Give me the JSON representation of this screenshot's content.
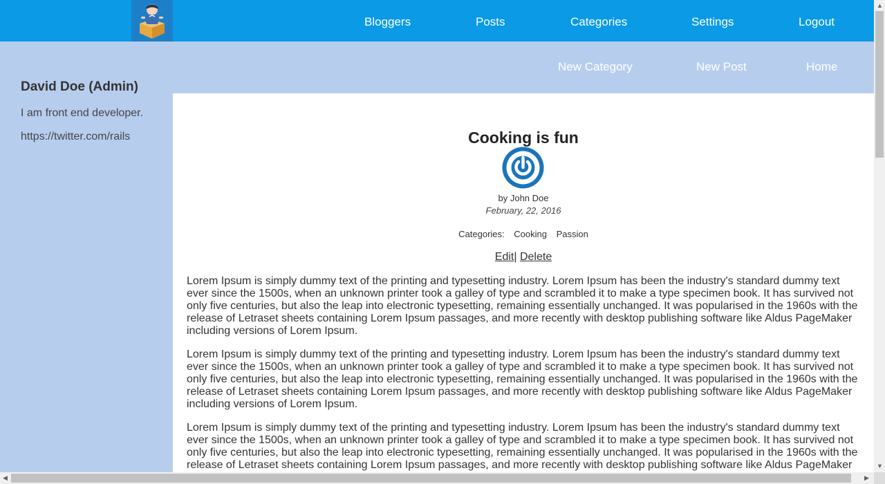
{
  "topnav": {
    "items": [
      {
        "label": "Bloggers"
      },
      {
        "label": "Posts"
      },
      {
        "label": "Categories"
      },
      {
        "label": "Settings"
      },
      {
        "label": "Logout"
      }
    ]
  },
  "subnav": {
    "items": [
      {
        "label": "New Category"
      },
      {
        "label": "New Post"
      },
      {
        "label": "Home"
      }
    ]
  },
  "sidebar": {
    "name": "David Doe (Admin)",
    "bio": "I am front end developer.",
    "link": "https://twitter.com/rails"
  },
  "post": {
    "title": "Cooking is fun",
    "author": "by John Doe",
    "date": "February, 22, 2016",
    "categories_label": "Categories:",
    "categories": [
      "Cooking",
      "Passion"
    ],
    "edit_label": "Edit",
    "separator": "|",
    "delete_label": "Delete",
    "paragraphs": [
      "Lorem Ipsum is simply dummy text of the printing and typesetting industry. Lorem Ipsum has been the industry's standard dummy text ever since the 1500s, when an unknown printer took a galley of type and scrambled it to make a type specimen book. It has survived not only five centuries, but also the leap into electronic typesetting, remaining essentially unchanged. It was popularised in the 1960s with the release of Letraset sheets containing Lorem Ipsum passages, and more recently with desktop publishing software like Aldus PageMaker including versions of Lorem Ipsum.",
      "Lorem Ipsum is simply dummy text of the printing and typesetting industry. Lorem Ipsum has been the industry's standard dummy text ever since the 1500s, when an unknown printer took a galley of type and scrambled it to make a type specimen book. It has survived not only five centuries, but also the leap into electronic typesetting, remaining essentially unchanged. It was popularised in the 1960s with the release of Letraset sheets containing Lorem Ipsum passages, and more recently with desktop publishing software like Aldus PageMaker including versions of Lorem Ipsum.",
      "Lorem Ipsum is simply dummy text of the printing and typesetting industry. Lorem Ipsum has been the industry's standard dummy text ever since the 1500s, when an unknown printer took a galley of type and scrambled it to make a type specimen book. It has survived not only five centuries, but also the leap into electronic typesetting, remaining essentially unchanged. It was popularised in the 1960s with the release of Letraset sheets containing Lorem Ipsum passages, and more recently with desktop publishing software like Aldus PageMaker including versions of Lorem Ipsum."
    ]
  },
  "colors": {
    "topbar": "#0a9ae6",
    "page_bg": "#b7cdee",
    "content_bg": "#ffffff",
    "icon_blue": "#1a74bb"
  },
  "icons": {
    "logo": "blogger-mascot-logo",
    "post": "power-icon"
  }
}
